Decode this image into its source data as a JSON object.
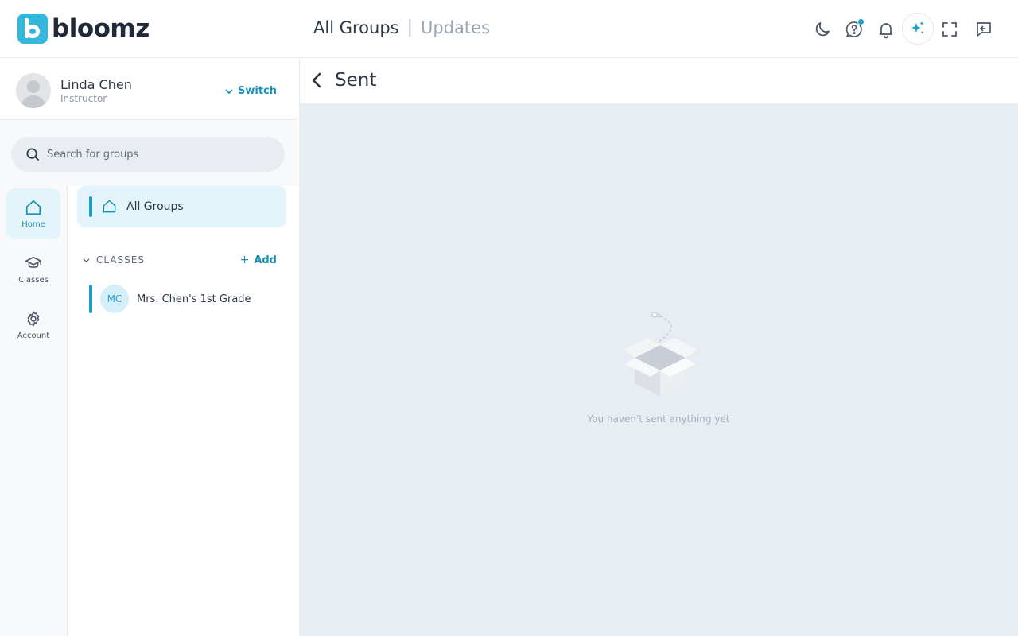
{
  "brand": {
    "name": "bloomz"
  },
  "header": {
    "title_active": "All Groups",
    "separator": "|",
    "title_inactive": "Updates",
    "icons": [
      "moon-icon",
      "help-icon",
      "bell-icon",
      "sparkle-icon",
      "fullscreen-icon",
      "exit-icon"
    ],
    "accent": "#1aa0c8"
  },
  "user": {
    "name": "Linda Chen",
    "role": "Instructor",
    "switch_label": "Switch"
  },
  "search": {
    "placeholder": "Search for groups"
  },
  "rail": {
    "items": [
      {
        "label": "Home",
        "icon": "home-icon",
        "active": true
      },
      {
        "label": "Classes",
        "icon": "graduation-cap-icon",
        "active": false
      },
      {
        "label": "Account",
        "icon": "gear-icon",
        "active": false
      }
    ]
  },
  "groups": {
    "all_groups_label": "All Groups",
    "classes_title": "CLASSES",
    "add_label": "Add",
    "add_symbol": "+",
    "classes": [
      {
        "initials": "MC",
        "name": "Mrs. Chen's 1st Grade"
      }
    ]
  },
  "main": {
    "title": "Sent",
    "empty_message": "You haven't sent anything yet"
  }
}
